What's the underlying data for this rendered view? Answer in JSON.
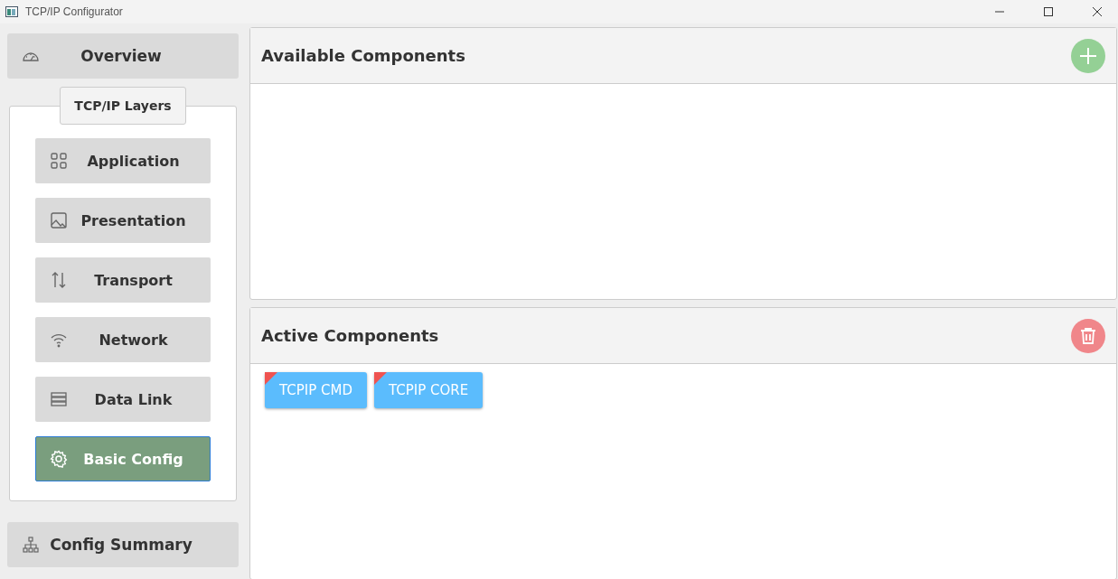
{
  "window": {
    "title": "TCP/IP Configurator"
  },
  "overview": {
    "label": "Overview"
  },
  "layers": {
    "title": "TCP/IP Layers",
    "items": [
      {
        "label": "Application",
        "selected": false
      },
      {
        "label": "Presentation",
        "selected": false
      },
      {
        "label": "Transport",
        "selected": false
      },
      {
        "label": "Network",
        "selected": false
      },
      {
        "label": "Data Link",
        "selected": false
      },
      {
        "label": "Basic Config",
        "selected": true
      }
    ]
  },
  "config_summary": {
    "label": "Config Summary"
  },
  "available_panel": {
    "title": "Available Components"
  },
  "active_panel": {
    "title": "Active Components",
    "components": [
      {
        "label": "TCPIP CMD",
        "flagged": true
      },
      {
        "label": "TCPIP CORE",
        "flagged": true
      }
    ]
  }
}
